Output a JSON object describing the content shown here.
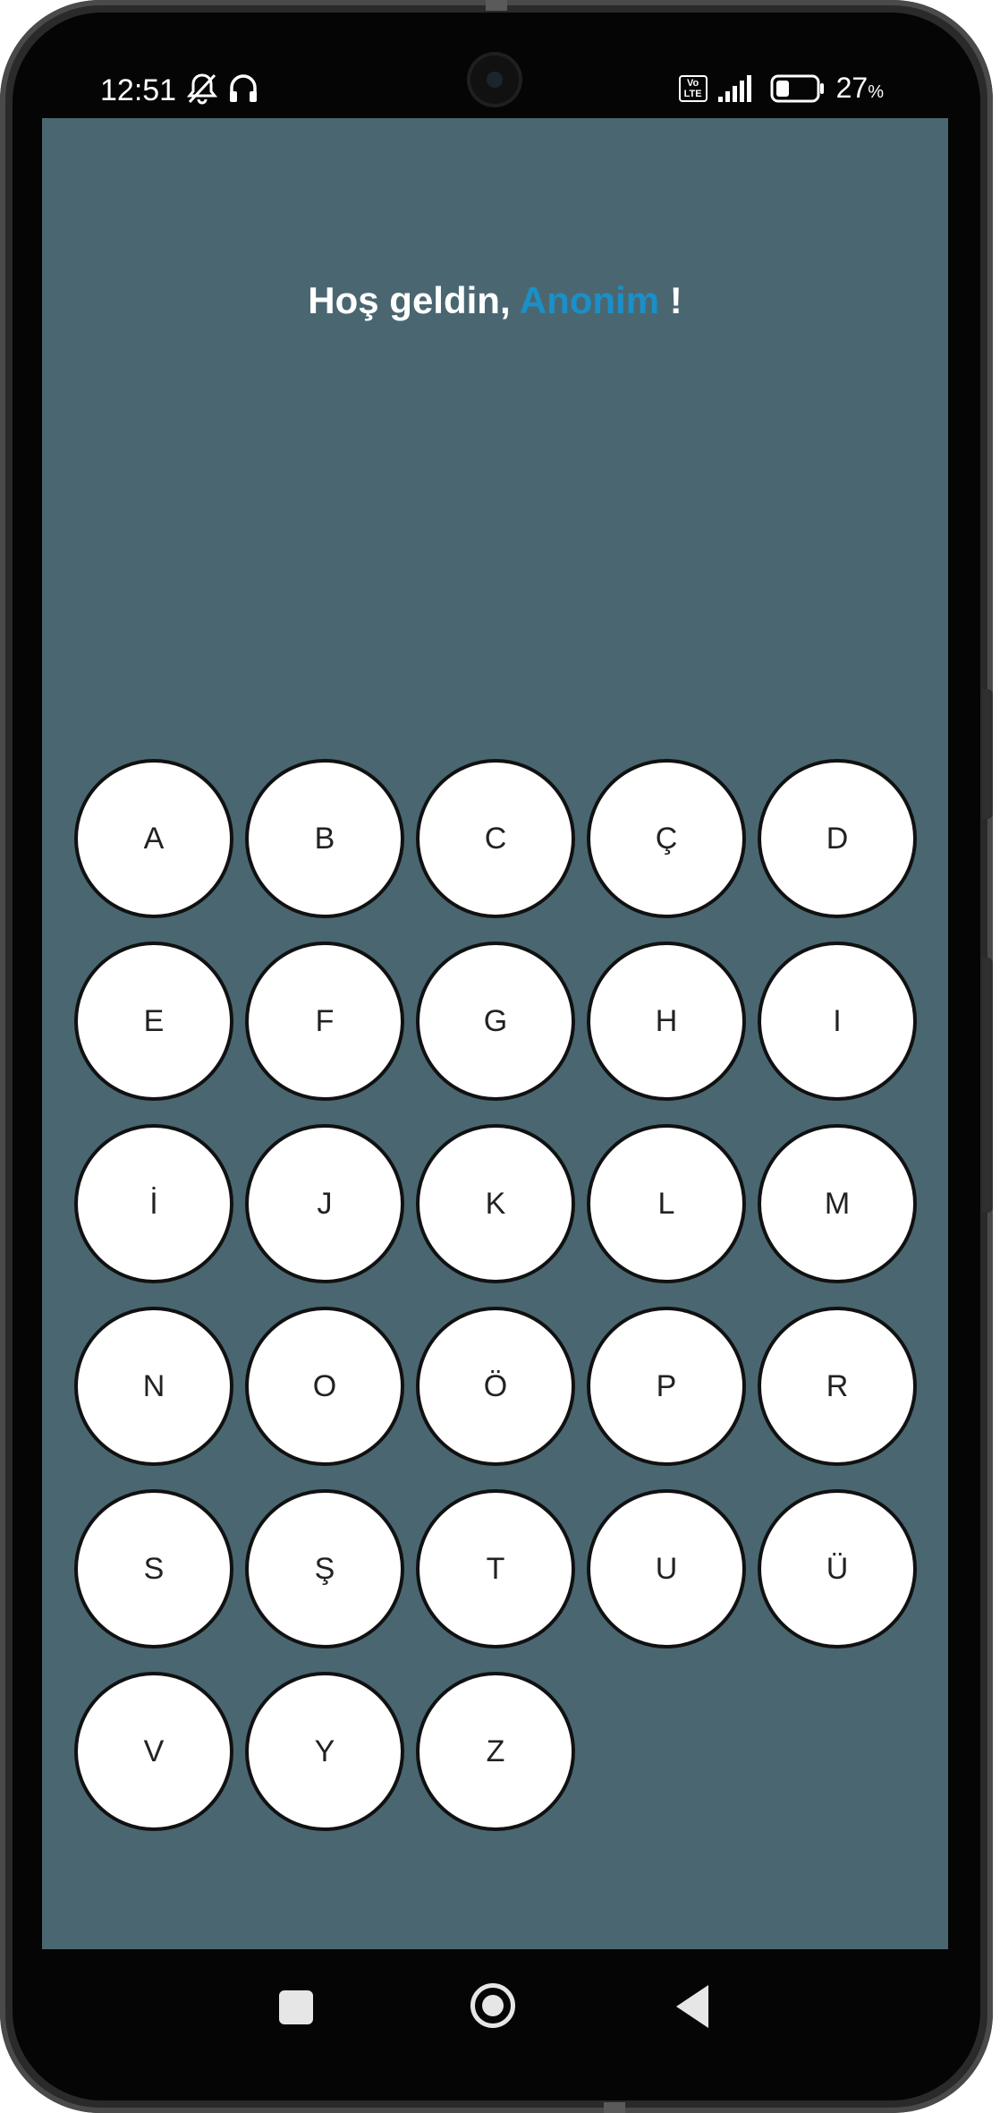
{
  "status_bar": {
    "time": "12:51",
    "icons": [
      "bell-off-icon",
      "headset-icon",
      "volte-icon",
      "signal-icon",
      "battery-icon"
    ],
    "volte_label": "Vo\nLTE",
    "battery_percent": "27",
    "battery_unit": "%"
  },
  "welcome": {
    "greeting": "Hoş geldin, ",
    "username": "Anonim",
    "suffix": " !"
  },
  "letters": [
    "A",
    "B",
    "C",
    "Ç",
    "D",
    "E",
    "F",
    "G",
    "H",
    "I",
    "İ",
    "J",
    "K",
    "L",
    "M",
    "N",
    "O",
    "Ö",
    "P",
    "R",
    "S",
    "Ş",
    "T",
    "U",
    "Ü",
    "V",
    "Y",
    "Z"
  ],
  "colors": {
    "screen_background": "#4a6771",
    "username_accent": "#1b8fc7",
    "button_fill": "#ffffff",
    "button_border": "#111111"
  },
  "nav_bar": {
    "icons": [
      "recents-square-icon",
      "home-circle-icon",
      "back-triangle-icon"
    ]
  }
}
